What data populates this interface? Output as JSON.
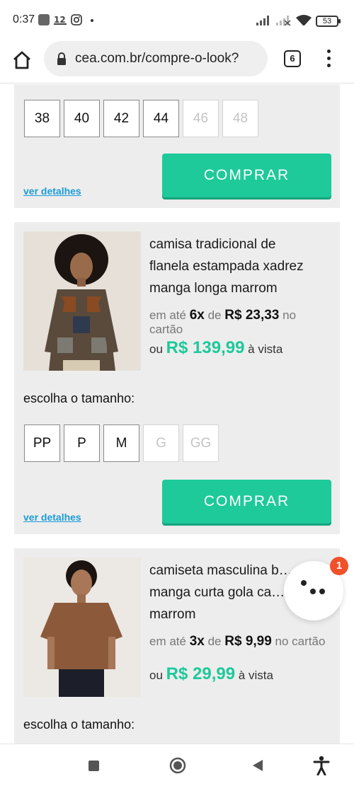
{
  "status_bar": {
    "time": "0:37",
    "battery": "53",
    "icons": [
      "gallery-icon",
      "carrier-icon",
      "instagram-icon",
      "dot-icon",
      "signal-icon",
      "signal-x-icon",
      "wifi-icon",
      "battery-icon"
    ]
  },
  "browser": {
    "url": "cea.com.br/compre-o-look?",
    "tab_count": "6"
  },
  "cards": [
    {
      "sizes": [
        {
          "label": "38",
          "available": true
        },
        {
          "label": "40",
          "available": true
        },
        {
          "label": "42",
          "available": true
        },
        {
          "label": "44",
          "available": true
        },
        {
          "label": "46",
          "available": false
        },
        {
          "label": "48",
          "available": false
        }
      ],
      "buy_label": "COMPRAR",
      "details_label": "ver detalhes"
    },
    {
      "name_lines": [
        "camisa tradicional de",
        "flanela estampada xadrez",
        "manga longa marrom"
      ],
      "installment_prefix": "em até",
      "installment_count": "6x",
      "installment_of": "de",
      "installment_value": "R$ 23,33",
      "installment_suffix": "no cartão",
      "cash_prefix": "ou",
      "cash_price": "R$ 139,99",
      "cash_suffix": "à vista",
      "choose_label": "escolha o tamanho:",
      "sizes": [
        {
          "label": "PP",
          "available": true
        },
        {
          "label": "P",
          "available": true
        },
        {
          "label": "M",
          "available": true
        },
        {
          "label": "G",
          "available": false
        },
        {
          "label": "GG",
          "available": false
        }
      ],
      "buy_label": "COMPRAR",
      "details_label": "ver detalhes"
    },
    {
      "name_lines": [
        "camiseta masculina b…",
        "manga curta gola ca…",
        "marrom"
      ],
      "installment_prefix": "em até",
      "installment_count": "3x",
      "installment_of": "de",
      "installment_value": "R$ 9,99",
      "installment_suffix": "no cartão",
      "cash_price": "R$ 29,99",
      "cash_suffix": "à vista",
      "choose_label": "escolha o tamanho:"
    }
  ],
  "chat": {
    "badge": "1"
  },
  "colors": {
    "accent": "#1ec99a",
    "link": "#1b9bd8",
    "badge": "#f0502a",
    "card_bg": "#ededed"
  }
}
